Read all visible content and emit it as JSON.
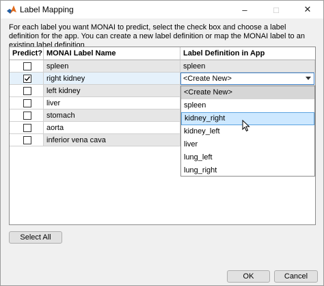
{
  "window": {
    "title": "Label Mapping",
    "minimize_icon": "minimize-icon",
    "maximize_icon": "maximize-icon",
    "close_icon": "close-icon"
  },
  "description": "For each label you want MONAI to predict, select the check box and choose a label definition for the app. You can create a new label definition or map the MONAI label to an existing label definition",
  "table": {
    "headers": [
      "Predict?",
      "MONAI Label Name",
      "Label Definition in App"
    ],
    "rows": [
      {
        "checked": false,
        "name": "spleen",
        "definition": "spleen"
      },
      {
        "checked": true,
        "name": "right kidney",
        "definition": "<Create New>"
      },
      {
        "checked": false,
        "name": "left kidney",
        "definition": ""
      },
      {
        "checked": false,
        "name": "liver",
        "definition": ""
      },
      {
        "checked": false,
        "name": "stomach",
        "definition": ""
      },
      {
        "checked": false,
        "name": "aorta",
        "definition": ""
      },
      {
        "checked": false,
        "name": "inferior vena cava",
        "definition": ""
      }
    ]
  },
  "dropdown": {
    "value": "<Create New>",
    "options": [
      "<Create New>",
      "spleen",
      "kidney_right",
      "kidney_left",
      "liver",
      "lung_left",
      "lung_right"
    ],
    "selected_option": "<Create New>",
    "hovered_option": "kidney_right"
  },
  "buttons": {
    "select_all": "Select All",
    "ok": "OK",
    "cancel": "Cancel"
  },
  "colors": {
    "accent": "#3b7dc4",
    "hover": "#cde8ff",
    "selected_row": "#e5f1fb"
  }
}
